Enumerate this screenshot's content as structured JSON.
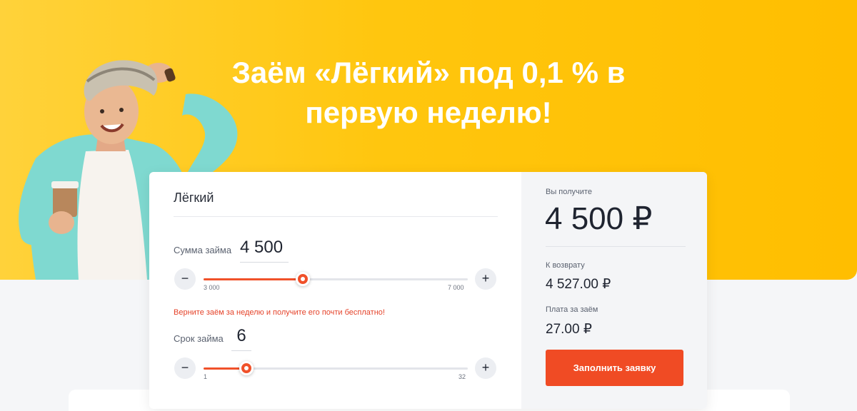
{
  "hero": {
    "headline_line1": "Заём «Лёгкий» под 0,1 % в",
    "headline_line2": "первую неделю!"
  },
  "calculator": {
    "product_name": "Лёгкий",
    "amount": {
      "label": "Сумма займа",
      "value": "4 500",
      "min_label": "3 000",
      "max_label": "7 000",
      "min": 3000,
      "max": 7000,
      "current": 4500
    },
    "promo_note": "Верните заём за неделю и получите его почти бесплатно!",
    "term": {
      "label": "Срок займа",
      "value": "6",
      "min_label": "1",
      "max_label": "32",
      "min": 1,
      "max": 32,
      "current": 6
    },
    "minus_label": "−",
    "plus_label": "+"
  },
  "summary": {
    "receive_label": "Вы получите",
    "receive_value": "4 500 ₽",
    "return_label": "К возврату",
    "return_value": "4 527.00 ₽",
    "fee_label": "Плата за заём",
    "fee_value": "27.00 ₽",
    "apply_button": "Заполнить заявку"
  },
  "colors": {
    "hero_yellow": "#ffc60e",
    "accent_orange": "#f0512a"
  }
}
